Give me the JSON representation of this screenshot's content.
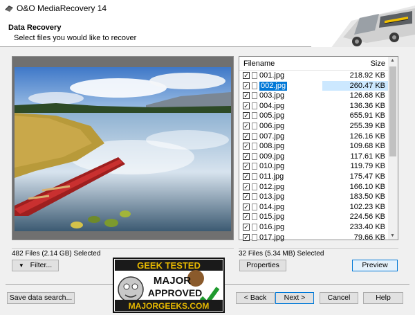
{
  "window": {
    "title": "O&O MediaRecovery 14",
    "controls": [
      "minimize-icon",
      "maximize-icon",
      "close-icon"
    ]
  },
  "header": {
    "title": "Data Recovery",
    "subtitle": "Select files you would like to recover"
  },
  "filelist": {
    "columns": {
      "name": "Filename",
      "size": "Size"
    },
    "rows": [
      {
        "name": "001.jpg",
        "size": "218.92 KB",
        "checked": true,
        "selected": false
      },
      {
        "name": "002.jpg",
        "size": "260.47 KB",
        "checked": true,
        "selected": true
      },
      {
        "name": "003.jpg",
        "size": "126.68 KB",
        "checked": true,
        "selected": false
      },
      {
        "name": "004.jpg",
        "size": "136.36 KB",
        "checked": true,
        "selected": false
      },
      {
        "name": "005.jpg",
        "size": "655.91 KB",
        "checked": true,
        "selected": false
      },
      {
        "name": "006.jpg",
        "size": "255.39 KB",
        "checked": true,
        "selected": false
      },
      {
        "name": "007.jpg",
        "size": "126.16 KB",
        "checked": true,
        "selected": false
      },
      {
        "name": "008.jpg",
        "size": "109.68 KB",
        "checked": true,
        "selected": false
      },
      {
        "name": "009.jpg",
        "size": "117.61 KB",
        "checked": true,
        "selected": false
      },
      {
        "name": "010.jpg",
        "size": "119.79 KB",
        "checked": true,
        "selected": false
      },
      {
        "name": "011.jpg",
        "size": "175.47 KB",
        "checked": true,
        "selected": false
      },
      {
        "name": "012.jpg",
        "size": "166.10 KB",
        "checked": true,
        "selected": false
      },
      {
        "name": "013.jpg",
        "size": "183.50 KB",
        "checked": true,
        "selected": false
      },
      {
        "name": "014.jpg",
        "size": "102.23 KB",
        "checked": true,
        "selected": false
      },
      {
        "name": "015.jpg",
        "size": "224.56 KB",
        "checked": true,
        "selected": false
      },
      {
        "name": "016.jpg",
        "size": "233.40 KB",
        "checked": true,
        "selected": false
      },
      {
        "name": "017.jpg",
        "size": "79.66 KB",
        "checked": true,
        "selected": false
      }
    ]
  },
  "status": {
    "left": "482 Files (2.14 GB) Selected",
    "right": "32 Files (5.34 MB) Selected"
  },
  "buttons": {
    "filter": "Filter...",
    "properties": "Properties",
    "preview": "Preview",
    "save_search": "Save data search...",
    "back": "< Back",
    "next": "Next >",
    "cancel": "Cancel",
    "help": "Help"
  },
  "watermark": {
    "line1": "GEEK TESTED",
    "line2": "MAJOR",
    "line3": "APPROVED",
    "line4": "MAJORGEEKS.COM"
  }
}
